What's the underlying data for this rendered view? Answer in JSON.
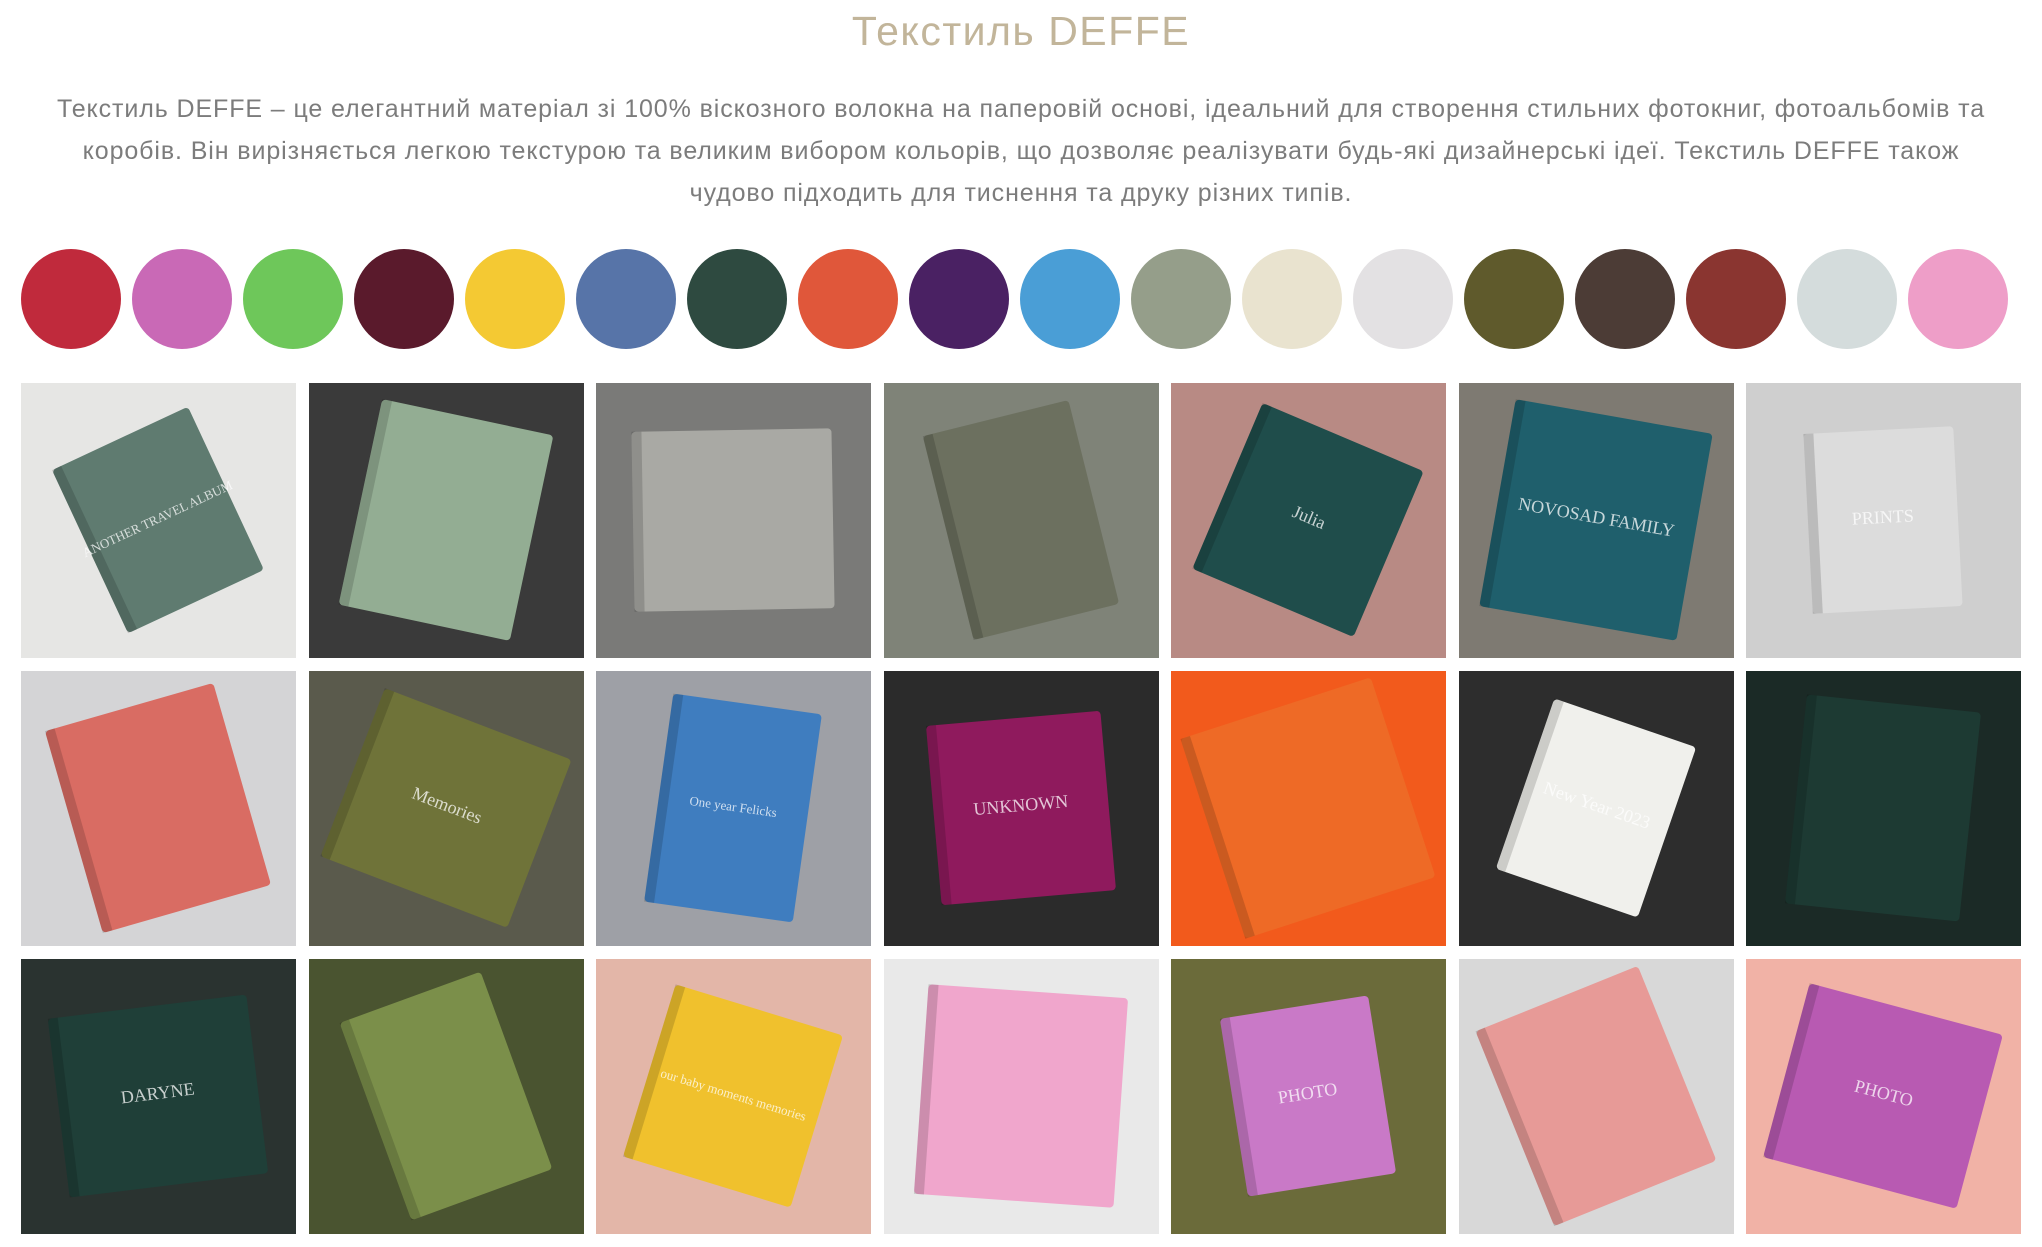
{
  "title": "Текстиль DEFFE",
  "description": "Текстиль DEFFE – це елегантний матеріал зі 100% віскозного волокна на паперовій основі, ідеальний для створення стильних фотокниг, фотоальбомів та коробів. Він вирізняється легкою текстурою та великим вибором кольорів, що дозволяє реалізувати будь-які дизайнерські ідеї. Текстиль DEFFE також чудово підходить для тиснення та друку різних типів.",
  "swatch_colors": [
    "#c02a3c",
    "#c969b6",
    "#6ec75a",
    "#5a1a2c",
    "#f4c933",
    "#5774a8",
    "#2e4a40",
    "#e0573a",
    "#4a2163",
    "#4a9ed6",
    "#959e8a",
    "#e9e3cf",
    "#e3e1e3",
    "#5f5a2c",
    "#4c3c36",
    "#8a3530",
    "#d4dcdc",
    "#ee9ec8"
  ],
  "photos": [
    {
      "bg": "#e6e6e4",
      "book": "#5f7b70",
      "text": "ANOTHER TRAVEL ALBUM"
    },
    {
      "bg": "#3a3a3a",
      "book": "#93ad93",
      "text": ""
    },
    {
      "bg": "#7a7a78",
      "book": "#a9a9a4",
      "text": ""
    },
    {
      "bg": "#7f8378",
      "book": "#6c705f",
      "text": ""
    },
    {
      "bg": "#b88a84",
      "book": "#1f4d4b",
      "text": "Julia"
    },
    {
      "bg": "#7e7a72",
      "book": "#1f5f6c",
      "text": "NOVOSAD FAMILY"
    },
    {
      "bg": "#cfcfcf",
      "book": "#dcdcdc",
      "text": "PRINTS"
    },
    {
      "bg": "#d4d4d6",
      "book": "#d96c63",
      "text": ""
    },
    {
      "bg": "#5a5a4c",
      "book": "#6f7339",
      "text": "Memories"
    },
    {
      "bg": "#9ea0a6",
      "book": "#3f7dbf",
      "text": "One year Felicks"
    },
    {
      "bg": "#2b2b2b",
      "book": "#8f1a5d",
      "text": "UNKNOWN"
    },
    {
      "bg": "#f25a1c",
      "book": "#ee6a26",
      "text": ""
    },
    {
      "bg": "#2d2d2d",
      "book": "#f0f0ec",
      "text": "New Year 2023"
    },
    {
      "bg": "#1b2a26",
      "book": "#1d3a33",
      "text": ""
    },
    {
      "bg": "#2a3330",
      "book": "#1f3f38",
      "text": "DARYNE"
    },
    {
      "bg": "#4a5430",
      "book": "#7b8f4a",
      "text": ""
    },
    {
      "bg": "#e3b6a8",
      "book": "#f0c12d",
      "text": "our baby moments memories"
    },
    {
      "bg": "#e9e9e9",
      "book": "#f0a6cc",
      "text": ""
    },
    {
      "bg": "#6b6b3a",
      "book": "#c979c7",
      "text": "PHOTO"
    },
    {
      "bg": "#d8d8d8",
      "book": "#e79a97",
      "text": ""
    },
    {
      "bg": "#f1b2a6",
      "book": "#b85ab2",
      "text": "PHOTO"
    }
  ]
}
